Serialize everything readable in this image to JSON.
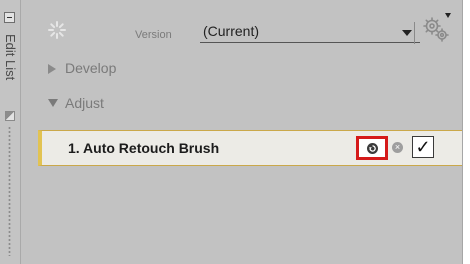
{
  "side_tab": {
    "label": "Edit List",
    "collapse_icon": "minus-icon"
  },
  "version": {
    "label": "Version",
    "selected": "(Current)",
    "spinner_icon": "loading-spinner-icon",
    "settings_icon": "gears-icon"
  },
  "tree": [
    {
      "label": "Develop",
      "expanded": false
    },
    {
      "label": "Adjust",
      "expanded": true
    }
  ],
  "step": {
    "label": "1. Auto Retouch Brush",
    "undo_icon": "undo-icon",
    "remove_icon": "remove-icon",
    "check_mark": "✓",
    "checked": true,
    "highlight_color": "#d51a1a",
    "accent_color": "#e2c352"
  }
}
